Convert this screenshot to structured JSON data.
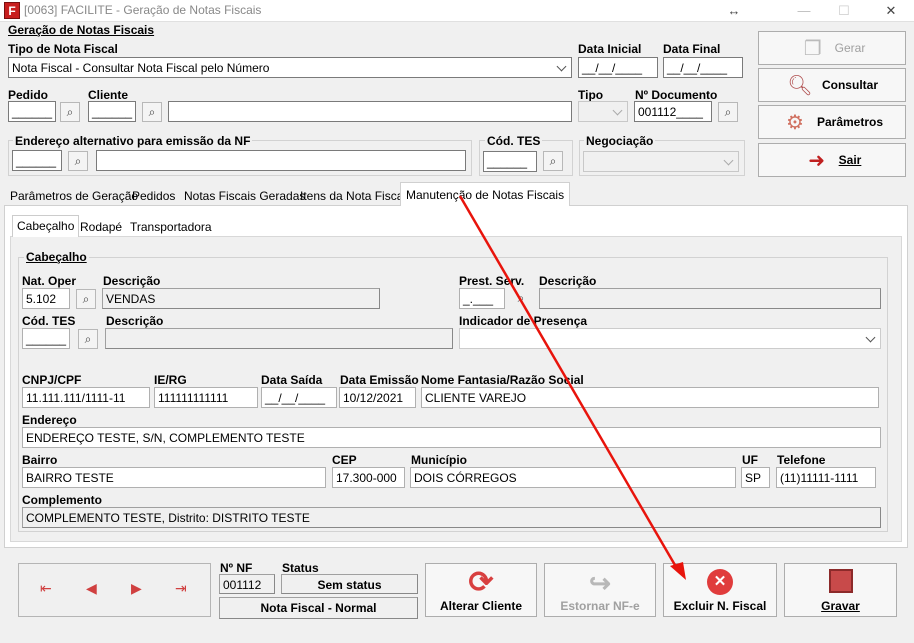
{
  "window": {
    "title": "[0063] FACILITE - Geração de Notas Fiscais",
    "logo_letter": "F",
    "resize_glyph": "↔",
    "minimize_glyph": "—",
    "maximize_glyph": "☐",
    "close_glyph": "✕"
  },
  "header": {
    "group_title": "Geração de Notas Fiscais",
    "tipo_label": "Tipo de Nota Fiscal",
    "tipo_value": "Nota Fiscal - Consultar Nota Fiscal pelo Número",
    "data_inicial_label": "Data Inicial",
    "data_inicial_value": "__/__/____",
    "data_final_label": "Data Final",
    "data_final_value": "__/__/____",
    "pedido_label": "Pedido",
    "pedido_value": "______",
    "cliente_label": "Cliente",
    "cliente_value": "______",
    "tipo_short_label": "Tipo",
    "num_documento_label": "Nº Documento",
    "num_documento_value": "001112____",
    "endereco_alt_label": "Endereço alternativo para emissão da NF",
    "endereco_alt_value": "______",
    "cod_tes_label": "Cód. TES",
    "cod_tes_value": "______",
    "negociacao_label": "Negociação"
  },
  "side_buttons": {
    "gerar": "Gerar",
    "consultar": "Consultar",
    "parametros": "Parâmetros",
    "sair": "Sair"
  },
  "tabs": [
    "Parâmetros de Geração",
    "Pedidos",
    "Notas Fiscais Geradas",
    "Itens da Nota Fiscal",
    "Manutenção de Notas Fiscais"
  ],
  "subtabs": [
    "Cabeçalho",
    "Rodapé",
    "Transportadora"
  ],
  "cabecalho": {
    "group_title": "Cabeçalho",
    "nat_oper_label": "Nat. Oper",
    "nat_oper_value": "5.102",
    "descricao_label": "Descrição",
    "nat_oper_desc": "VENDAS",
    "prest_serv_label": "Prest. Serv.",
    "prest_serv_value": "_.___",
    "prest_desc_label": "Descrição",
    "cod_tes_label": "Cód. TES",
    "cod_tes_value": "______",
    "tes_desc_label": "Descrição",
    "indicador_label": "Indicador de Presença",
    "cnpj_label": "CNPJ/CPF",
    "cnpj_value": "11.111.111/1111-11",
    "ie_label": "IE/RG",
    "ie_value": "111111111111",
    "data_saida_label": "Data Saída",
    "data_saida_value": "__/__/____",
    "data_emissao_label": "Data Emissão",
    "data_emissao_value": "10/12/2021",
    "nome_label": "Nome Fantasia/Razão Social",
    "nome_value": "CLIENTE VAREJO",
    "endereco_label": "Endereço",
    "endereco_value": "ENDEREÇO TESTE, S/N, COMPLEMENTO TESTE",
    "bairro_label": "Bairro",
    "bairro_value": "BAIRRO TESTE",
    "cep_label": "CEP",
    "cep_value": "17.300-000",
    "municipio_label": "Município",
    "municipio_value": "DOIS CÓRREGOS",
    "uf_label": "UF",
    "uf_value": "SP",
    "telefone_label": "Telefone",
    "telefone_value": "(11)11111-1111",
    "complemento_label": "Complemento",
    "complemento_value": "COMPLEMENTO TESTE, Distrito: DISTRITO TESTE"
  },
  "footer": {
    "nf_label": "Nº NF",
    "nf_value": "001112",
    "status_label": "Status",
    "status_value": "Sem status",
    "nf_type": "Nota Fiscal - Normal",
    "alterar_cliente": "Alterar Cliente",
    "estornar": "Estornar NF-e",
    "excluir": "Excluir N. Fiscal",
    "gravar": "Gravar"
  },
  "annotation": {
    "arrow_color": "#e8140c"
  }
}
